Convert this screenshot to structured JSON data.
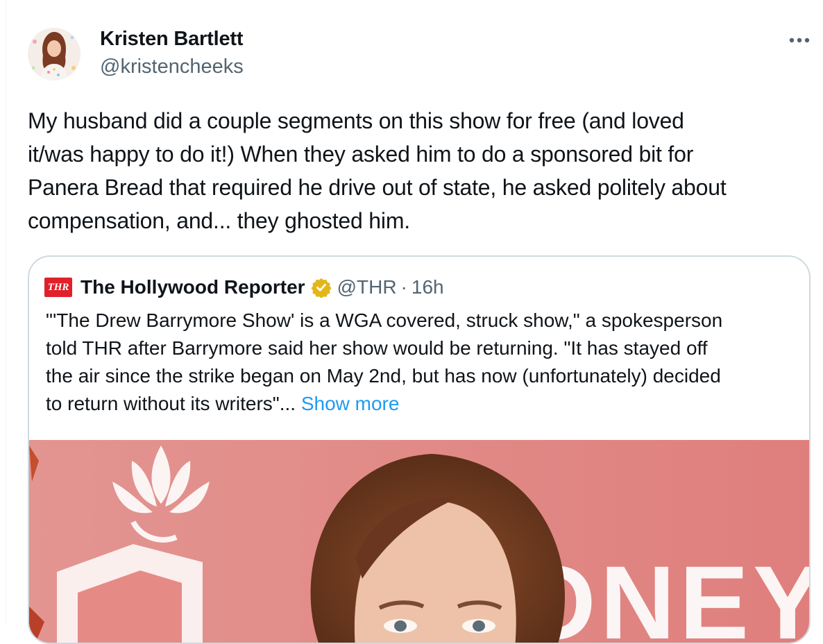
{
  "tweet": {
    "author": {
      "name": "Kristen Bartlett",
      "handle": "@kristencheeks",
      "avatar_icon": "avatar-photo"
    },
    "more_icon": "more-dots-icon",
    "text": "My husband did a couple segments on this show for free (and loved\nit/was happy to do it!) When they asked him to do a sponsored bit for\nPanera Bread that required he drive out of state, he asked politely about\ncompensation, and... they ghosted him."
  },
  "quote": {
    "logo_text": "THR",
    "name": "The Hollywood Reporter",
    "verified_icon": "verified-gold-badge-icon",
    "handle": "@THR",
    "separator": "·",
    "time": "16h",
    "text": "\"'The Drew Barrymore Show' is a WGA covered, struck show,\" a spokesperson\ntold THR after Barrymore said her show would be returning. \"It has stayed off\nthe air since the strike began on May 2nd, but has now (unfortunately) decided\nto return without its writers\"... ",
    "show_more": "Show more",
    "image_icon": "media-photo",
    "image_backdrop_text": "ONEY"
  },
  "colors": {
    "text": "#0f1419",
    "secondary": "#536471",
    "link": "#1d9bf0",
    "border": "#cfd9de",
    "verified_gold": "#e2b719",
    "thr_red": "#e0202a",
    "backdrop": "#e48b86"
  }
}
